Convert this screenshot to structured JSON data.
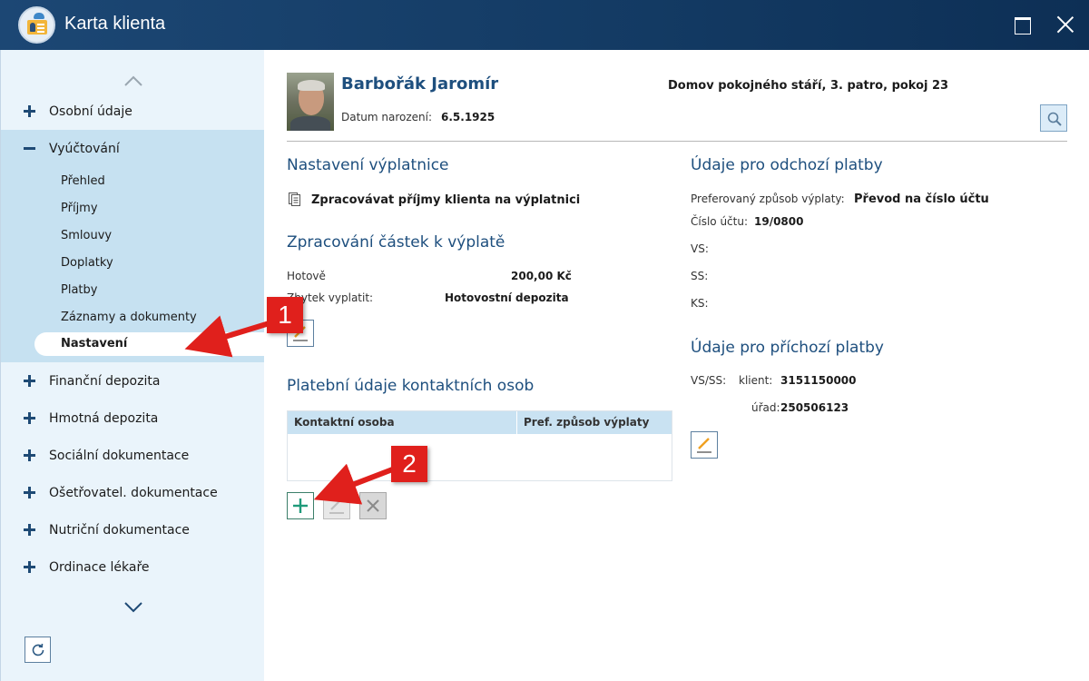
{
  "window": {
    "title": "Karta klienta"
  },
  "sidebar": {
    "items": [
      {
        "label": "Osobní údaje",
        "expanded": false
      },
      {
        "label": "Vyúčtování",
        "expanded": true
      },
      {
        "label": "Finanční depozita",
        "expanded": false
      },
      {
        "label": "Hmotná depozita",
        "expanded": false
      },
      {
        "label": "Sociální dokumentace",
        "expanded": false
      },
      {
        "label": "Ošetřovatel. dokumentace",
        "expanded": false
      },
      {
        "label": "Nutriční dokumentace",
        "expanded": false
      },
      {
        "label": "Ordinace lékaře",
        "expanded": false
      }
    ],
    "subitems": [
      "Přehled",
      "Příjmy",
      "Smlouvy",
      "Doplatky",
      "Platby",
      "Záznamy a dokumenty",
      "Nastavení"
    ],
    "active_subitem": "Nastavení"
  },
  "client": {
    "name": "Barbořák Jaromír",
    "birth_label": "Datum narození:",
    "birth_date": "6.5.1925",
    "location": "Domov pokojného stáří, 3. patro, pokoj 23"
  },
  "payroll": {
    "title": "Nastavení výplatnice",
    "process_label": "Zpracovávat příjmy klienta na výplatnici"
  },
  "amounts": {
    "title": "Zpracování částek k výplatě",
    "cash_label": "Hotově",
    "cash_value": "200,00 Kč",
    "rest_label": "Zbytek vyplatit:",
    "rest_value": "Hotovostní depozita"
  },
  "contacts": {
    "title": "Platební údaje kontaktních osob",
    "columns": [
      "Kontaktní osoba",
      "Pref. způsob výplaty"
    ],
    "rows": []
  },
  "outgoing": {
    "title": "Údaje pro odchozí platby",
    "method_label": "Preferovaný způsob výplaty:",
    "method_value": "Převod na číslo účtu",
    "account_label": "Číslo účtu:",
    "account_value": "19/0800",
    "vs_label": "VS:",
    "ss_label": "SS:",
    "ks_label": "KS:"
  },
  "incoming": {
    "title": "Údaje pro příchozí platby",
    "vsss_label": "VS/SS:",
    "client_label": "klient:",
    "client_value": "3151150000",
    "office_label": "úřad:",
    "office_value": "250506123"
  },
  "annotations": {
    "badge1": "1",
    "badge2": "2"
  },
  "colors": {
    "titlebar": "#133a63",
    "sidebar_bg": "#eaf4fb",
    "sidebar_expanded": "#c6e1f1",
    "heading": "#1e4f7e",
    "annotation": "#e0201c"
  }
}
